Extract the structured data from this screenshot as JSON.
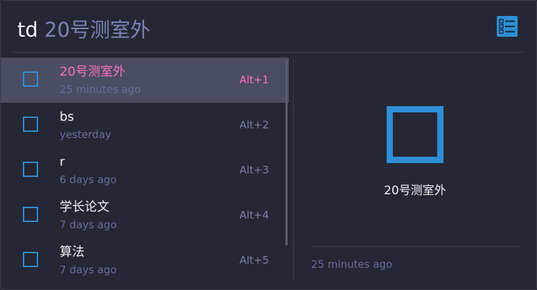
{
  "search": {
    "keyword": "td",
    "query": " 20号测室外"
  },
  "header": {
    "app_icon": "checklist-icon",
    "accent_color": "#2e8fd6"
  },
  "results": [
    {
      "title": "20号测室外",
      "time": "25 minutes ago",
      "shortcut": "Alt+1",
      "icon": "checkbox-icon",
      "selected": true
    },
    {
      "title": "bs",
      "time": "yesterday",
      "shortcut": "Alt+2",
      "icon": "checkbox-icon",
      "selected": false
    },
    {
      "title": "r",
      "time": "6 days ago",
      "shortcut": "Alt+3",
      "icon": "checkbox-icon",
      "selected": false
    },
    {
      "title": "学长论文",
      "time": "7 days ago",
      "shortcut": "Alt+4",
      "icon": "checkbox-icon",
      "selected": false
    },
    {
      "title": "算法",
      "time": "7 days ago",
      "shortcut": "Alt+5",
      "icon": "checkbox-icon",
      "selected": false
    }
  ],
  "preview": {
    "icon": "checkbox-icon",
    "title": "20号测室外",
    "time": "25 minutes ago"
  }
}
